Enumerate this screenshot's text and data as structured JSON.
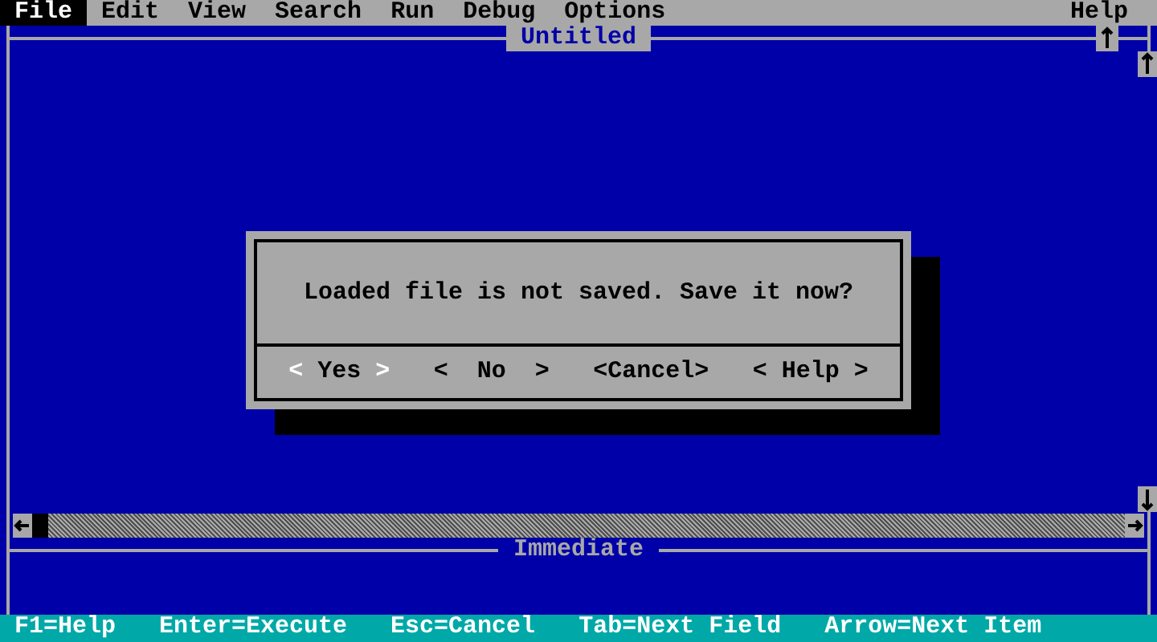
{
  "menu": [
    {
      "label": "File",
      "selected": true
    },
    {
      "label": "Edit",
      "selected": false
    },
    {
      "label": "View",
      "selected": false
    },
    {
      "label": "Search",
      "selected": false
    },
    {
      "label": "Run",
      "selected": false
    },
    {
      "label": "Debug",
      "selected": false
    },
    {
      "label": "Options",
      "selected": false
    }
  ],
  "help_menu": {
    "label": "Help",
    "selected": false
  },
  "editor": {
    "title": "Untitled"
  },
  "immediate": {
    "title": "Immediate"
  },
  "dialog": {
    "message": "Loaded file is not saved. Save it now?",
    "buttons": [
      {
        "open": "<",
        "label": "Yes",
        "close": ">",
        "selected": true
      },
      {
        "open": "<",
        "label": "No",
        "close": ">",
        "selected": false
      },
      {
        "open": "<",
        "label": "Cancel",
        "close": ">",
        "selected": false
      },
      {
        "open": "<",
        "label": "Help",
        "close": ">",
        "selected": false
      }
    ]
  },
  "status_bar": [
    "F1=Help",
    "Enter=Execute",
    "Esc=Cancel",
    "Tab=Next Field",
    "Arrow=Next Item"
  ]
}
